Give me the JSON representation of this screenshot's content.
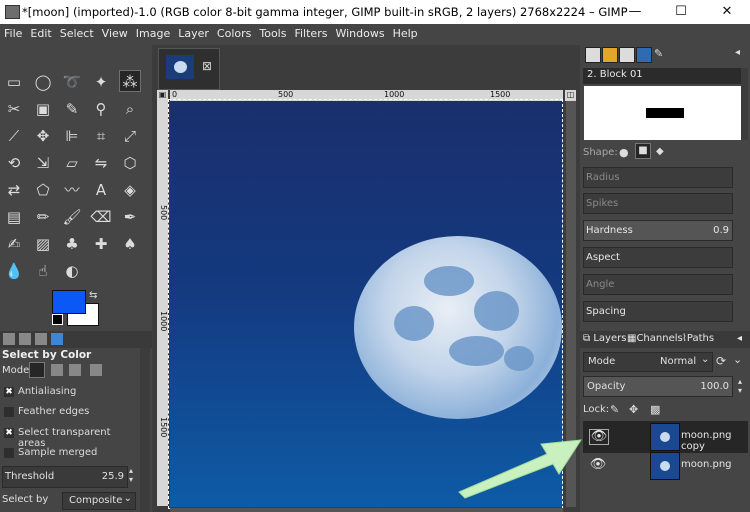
{
  "window": {
    "title": "*[moon] (imported)-1.0 (RGB color 8-bit gamma integer, GIMP built-in sRGB, 2 layers) 2768x2224 – GIMP",
    "minimize": "—",
    "maximize": "☐",
    "close": "✕"
  },
  "menu": [
    "File",
    "Edit",
    "Select",
    "View",
    "Image",
    "Layer",
    "Colors",
    "Tools",
    "Filters",
    "Windows",
    "Help"
  ],
  "image_tab": {
    "close": "⊠"
  },
  "rulers": {
    "h": [
      "0",
      "500",
      "1000",
      "1500"
    ],
    "v": [
      "500",
      "1000",
      "1500"
    ]
  },
  "tool_options": {
    "title": "Select by Color",
    "mode_label": "Mode:",
    "antialiasing": "Antialiasing",
    "feather_edges": "Feather edges",
    "select_transparent": "Select transparent areas",
    "sample_merged": "Sample merged",
    "threshold_label": "Threshold",
    "threshold_value": "25.9",
    "select_by_label": "Select by",
    "select_by_value": "Composite"
  },
  "brush": {
    "name": "2. Block 01",
    "shape_label": "Shape:",
    "sliders": [
      {
        "label": "Radius",
        "value": ""
      },
      {
        "label": "Spikes",
        "value": ""
      },
      {
        "label": "Hardness",
        "value": "0.9"
      },
      {
        "label": "Aspect",
        "value": ""
      },
      {
        "label": "Angle",
        "value": ""
      },
      {
        "label": "Spacing",
        "value": ""
      }
    ]
  },
  "layers_panel": {
    "tabs": [
      "Layers",
      "Channels",
      "Paths"
    ],
    "mode_label": "Mode",
    "mode_value": "Normal",
    "opacity_label": "Opacity",
    "opacity_value": "100.0",
    "lock_label": "Lock:",
    "layers": [
      {
        "name": "moon.png copy"
      },
      {
        "name": "moon.png"
      }
    ]
  },
  "colors": {
    "foreground": "#0a58f5",
    "background": "#ffffff",
    "arrow": "#c9f1c0"
  }
}
